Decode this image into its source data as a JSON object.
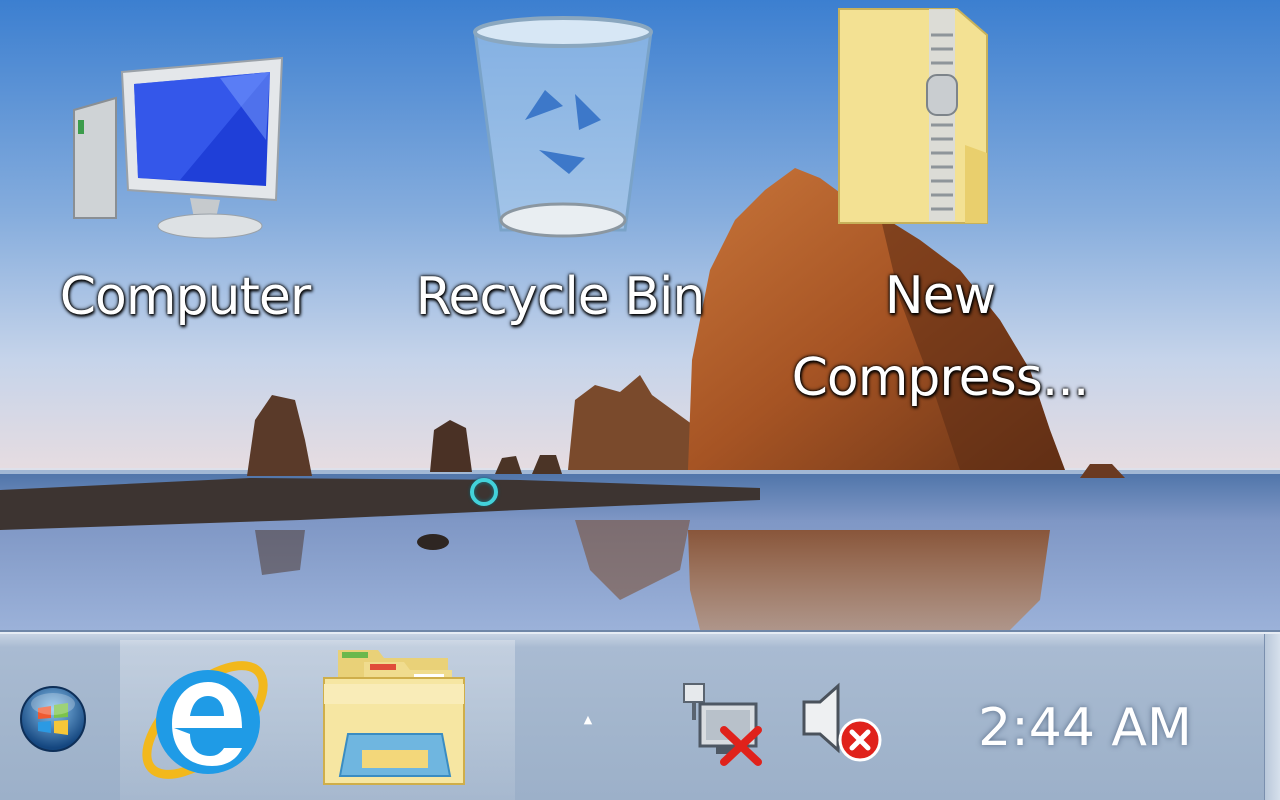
{
  "desktop": {
    "icons": [
      {
        "label": "Computer",
        "icon": "computer-icon"
      },
      {
        "label": "Recycle Bin",
        "icon": "recycle-bin-icon"
      },
      {
        "label": "New\nCompress...",
        "icon": "zip-folder-icon"
      }
    ]
  },
  "taskbar": {
    "start": {
      "icon": "windows-orb-icon"
    },
    "pinned": [
      {
        "icon": "internet-explorer-icon"
      },
      {
        "icon": "windows-explorer-icon"
      }
    ],
    "tray": {
      "overflow_glyph": "▲",
      "network_icon": "network-disconnected-icon",
      "volume_icon": "volume-muted-icon"
    },
    "clock": "2:44 AM"
  },
  "colors": {
    "taskbar": "#a3b6cd",
    "sky_top": "#3f7fcf",
    "cursor_ring": "#43d2da"
  }
}
